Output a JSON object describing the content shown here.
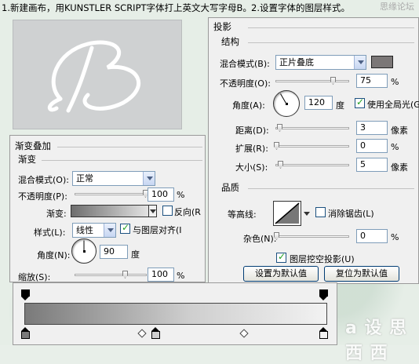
{
  "captions": {
    "step1": "1.新建画布，用KUNSTLER SCRIPT字体打上英文大写字母B。",
    "step2": "2.设置字体的图层样式。",
    "corner": "思缘论坛"
  },
  "canvas": {
    "letter": "B",
    "bg": "#cfd1d2"
  },
  "drop_shadow": {
    "title": "投影",
    "group": "结构",
    "blend_mode_label": "混合模式(B):",
    "blend_mode_value": "正片叠底",
    "shadow_color": "#7b7777",
    "opacity_label": "不透明度(O):",
    "opacity_value": "75",
    "opacity_unit": "%",
    "opacity_level": 0.75,
    "angle_label": "角度(A):",
    "angle_value": "120",
    "angle_unit": "度",
    "global_light_label": "使用全局光(G)",
    "global_light_checked": true,
    "distance_label": "距离(D):",
    "distance_value": "3",
    "distance_unit": "像素",
    "spread_label": "扩展(R):",
    "spread_value": "0",
    "spread_unit": "%",
    "size_label": "大小(S):",
    "size_value": "5",
    "size_unit": "像素",
    "quality_title": "品质",
    "contour_label": "等高线:",
    "anti_alias_label": "消除锯齿(L)",
    "anti_alias_checked": false,
    "noise_label": "杂色(N):",
    "noise_value": "0",
    "noise_unit": "%",
    "knockout_label": "图层挖空投影(U)",
    "knockout_checked": true,
    "make_default_label": "设置为默认值",
    "reset_default_label": "复位为默认值"
  },
  "gradient_overlay": {
    "title": "渐变叠加",
    "group": "渐变",
    "blend_mode_label": "混合模式(O):",
    "blend_mode_value": "正常",
    "opacity_label": "不透明度(P):",
    "opacity_value": "100",
    "opacity_unit": "%",
    "opacity_level": 1.0,
    "gradient_label": "渐变:",
    "reverse_label": "反向(R",
    "reverse_checked": false,
    "style_label": "样式(L):",
    "style_value": "线性",
    "align_label": "与图层对齐(I",
    "align_checked": true,
    "angle_label": "角度(N):",
    "angle_value": "90",
    "angle_unit": "度",
    "scale_label": "缩放(S):",
    "scale_value": "100",
    "scale_unit": "%"
  },
  "gradient_editor": {
    "stops_colors": [
      "#7a7a7a",
      "#f2f2f2"
    ],
    "watermark": "a 设 思 西 西"
  }
}
